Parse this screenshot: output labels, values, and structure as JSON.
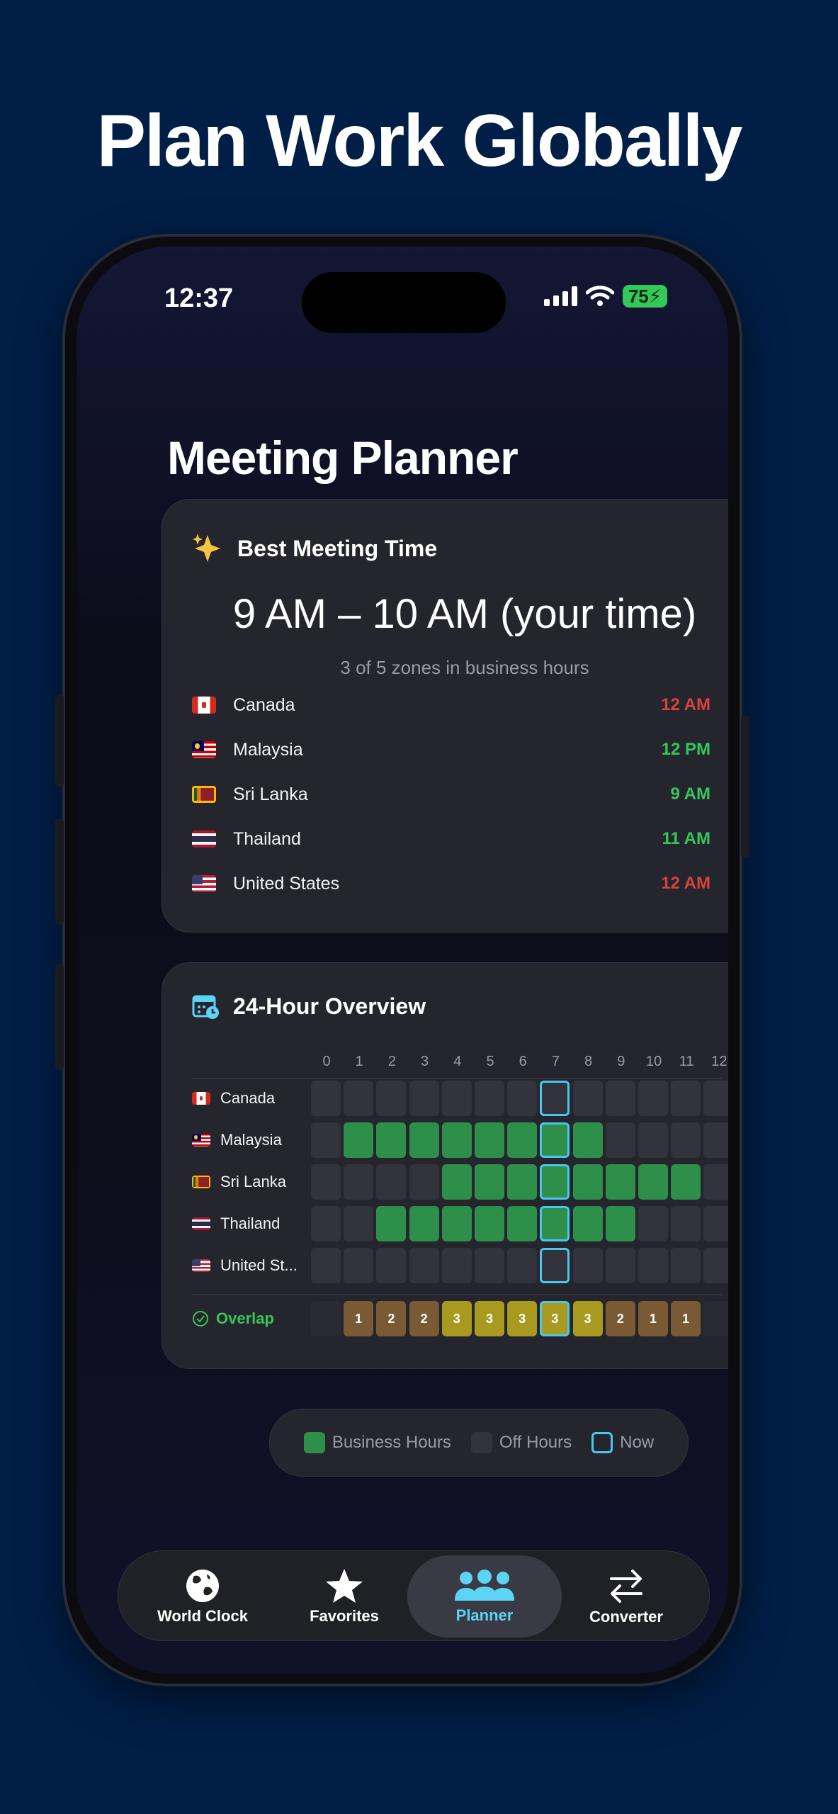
{
  "headline": "Plan Work Globally",
  "status": {
    "time": "12:37",
    "battery": "75"
  },
  "page_title": "Meeting Planner",
  "best_meeting": {
    "title": "Best Meeting Time",
    "time_range": "9 AM – 10 AM (your time)",
    "subtitle": "3 of 5 zones in business hours",
    "zones": [
      {
        "name": "Canada",
        "time": "12 AM",
        "status": "off"
      },
      {
        "name": "Malaysia",
        "time": "12 PM",
        "status": "business"
      },
      {
        "name": "Sri Lanka",
        "time": "9 AM",
        "status": "business"
      },
      {
        "name": "Thailand",
        "time": "11 AM",
        "status": "business"
      },
      {
        "name": "United States",
        "time": "12 AM",
        "status": "off"
      }
    ]
  },
  "overview": {
    "title": "24-Hour Overview",
    "hours": [
      "0",
      "1",
      "2",
      "3",
      "4",
      "5",
      "6",
      "7",
      "8",
      "9",
      "10",
      "11",
      "12"
    ],
    "rows": [
      {
        "label": "Canada",
        "business": [
          0,
          0,
          0,
          0,
          0,
          0,
          0,
          0,
          0,
          0,
          0,
          0,
          0,
          1
        ]
      },
      {
        "label": "Malaysia",
        "business": [
          0,
          1,
          1,
          1,
          1,
          1,
          1,
          1,
          1,
          0,
          0,
          0,
          0,
          0
        ]
      },
      {
        "label": "Sri Lanka",
        "business": [
          0,
          0,
          0,
          0,
          1,
          1,
          1,
          1,
          1,
          1,
          1,
          1,
          0,
          0
        ]
      },
      {
        "label": "Thailand",
        "business": [
          0,
          0,
          1,
          1,
          1,
          1,
          1,
          1,
          1,
          1,
          0,
          0,
          0,
          0
        ]
      },
      {
        "label": "United St...",
        "business": [
          0,
          0,
          0,
          0,
          0,
          0,
          0,
          0,
          0,
          0,
          0,
          0,
          0,
          1
        ]
      }
    ],
    "now_index": 7,
    "overlap_label": "Overlap",
    "overlap": [
      "",
      "1",
      "2",
      "2",
      "3",
      "3",
      "3",
      "3",
      "3",
      "2",
      "1",
      "1",
      "",
      ""
    ]
  },
  "legend": {
    "business": "Business Hours",
    "off": "Off Hours",
    "now": "Now"
  },
  "tabs": [
    {
      "label": "World Clock",
      "icon": "globe-icon"
    },
    {
      "label": "Favorites",
      "icon": "star-icon"
    },
    {
      "label": "Planner",
      "icon": "people-icon",
      "active": true
    },
    {
      "label": "Converter",
      "icon": "arrows-icon"
    }
  ],
  "colors": {
    "background": "#001e46",
    "business": "#2e8f4a",
    "off_hours": "#33333c",
    "now": "#4ac6f0",
    "overlap_3": "#a89a1e",
    "overlap_2": "#7a5a35",
    "overlap_1": "#7a5a35",
    "accent": "#5bd4f5"
  }
}
